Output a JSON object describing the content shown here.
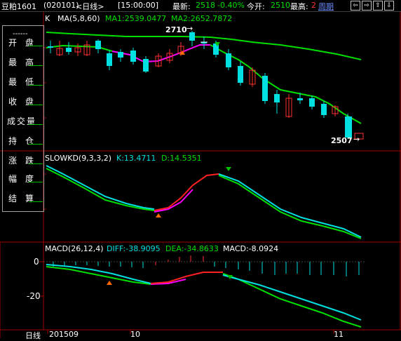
{
  "header": {
    "symbol": "豆粕1601",
    "code": "(020101)",
    "period": "<日线>",
    "time": "[15:00:00]",
    "latest_label": "最新:",
    "latest_value": "2518",
    "change_pct": "-0.40%",
    "open_label": "今开:",
    "open_value": "2510",
    "high_label": "最高:",
    "high_value": "2",
    "period_button": "周期",
    "nav_buttons": [
      "⇦",
      "⇨",
      "⇧",
      "⇩"
    ]
  },
  "left_panel": {
    "top": "------",
    "items": [
      "开盘",
      "最高",
      "最低",
      "收盘",
      "成交量",
      "持仓",
      "涨跌",
      "幅度",
      "结算"
    ]
  },
  "price_panel": {
    "legend_k": "K",
    "legend_ma": "MA(5,8,60)",
    "ma1": "MA1:2539.0477",
    "ma2": "MA2:2652.7872",
    "high_marker": "2710",
    "low_marker": "2507"
  },
  "kd_panel": {
    "title": "SLOWKD(9,3,3,2)",
    "k": "K:13.4711",
    "d": "D:14.5351"
  },
  "macd_panel": {
    "title": "MACD(26,12,4)",
    "diff": "DIFF:-38.9095",
    "dea": "DEA:-34.8633",
    "macd": "MACD:-8.0924",
    "axis_0": "0",
    "axis_neg20": "-20"
  },
  "footer": {
    "period_label": "日线",
    "dates": [
      "201509",
      "10",
      "11"
    ]
  },
  "colors": {
    "up": "#ff3030",
    "down": "#00e0e0",
    "ma_line": "#00e000",
    "k_line": "#00e0e0",
    "d_line": "#00e000",
    "highlight": "#ff00ff",
    "grid": "#a00000"
  }
}
